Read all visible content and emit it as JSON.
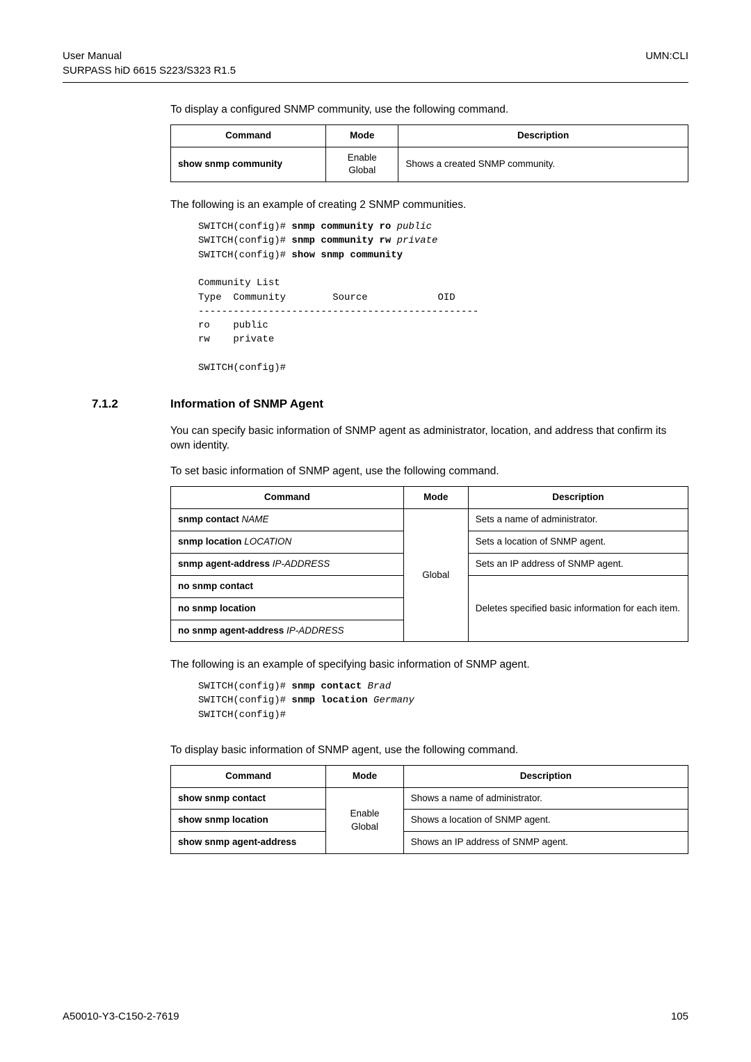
{
  "header": {
    "left_line1": "User Manual",
    "left_line2": "SURPASS hiD 6615 S223/S323 R1.5",
    "right": "UMN:CLI"
  },
  "p1": "To display a configured SNMP community, use the following command.",
  "table1": {
    "h_cmd": "Command",
    "h_mode": "Mode",
    "h_desc": "Description",
    "r1_cmd": "show snmp community",
    "r1_mode1": "Enable",
    "r1_mode2": "Global",
    "r1_desc": "Shows a created SNMP community."
  },
  "p2": "The following is an example of creating 2 SNMP communities.",
  "cli1": {
    "l1a": "SWITCH(config)# ",
    "l1b": "snmp community ro",
    "l1c": " public",
    "l2a": "SWITCH(config)# ",
    "l2b": "snmp community rw",
    "l2c": " private",
    "l3a": "SWITCH(config)# ",
    "l3b": "show snmp community",
    "blank1": "",
    "l4": "Community List",
    "l5": "Type  Community        Source            OID",
    "l6": "------------------------------------------------",
    "l7": "ro    public",
    "l8": "rw    private",
    "blank2": "",
    "l9": "SWITCH(config)#"
  },
  "section": {
    "num": "7.1.2",
    "title": "Information of SNMP Agent"
  },
  "p3": "You can specify basic information of SNMP agent as administrator, location, and address that confirm its own identity.",
  "p4": "To set basic information of SNMP agent, use the following command.",
  "table2": {
    "h_cmd": "Command",
    "h_mode": "Mode",
    "h_desc": "Description",
    "r1_cmd_b": "snmp contact",
    "r1_cmd_i": " NAME",
    "r1_desc": "Sets a name of administrator.",
    "r2_cmd_b": "snmp location",
    "r2_cmd_i": " LOCATION",
    "r2_desc": "Sets a location of SNMP agent.",
    "r3_cmd_b": "snmp agent-address",
    "r3_cmd_i": " IP-ADDRESS",
    "r3_desc": "Sets an IP address of SNMP agent.",
    "mode": "Global",
    "r4_cmd": "no snmp contact",
    "r5_cmd": "no snmp location",
    "r6_cmd_b": "no snmp agent-address",
    "r6_cmd_i": " IP-ADDRESS",
    "del_desc": "Deletes specified basic information for each item."
  },
  "p5": "The following is an example of specifying basic information of SNMP agent.",
  "cli2": {
    "l1a": "SWITCH(config)# ",
    "l1b": "snmp contact",
    "l1c": " Brad",
    "l2a": "SWITCH(config)# ",
    "l2b": "snmp location",
    "l2c": " Germany",
    "l3": "SWITCH(config)#"
  },
  "p6": "To display basic information of SNMP agent, use the following command.",
  "table3": {
    "h_cmd": "Command",
    "h_mode": "Mode",
    "h_desc": "Description",
    "r1_cmd": "show snmp contact",
    "r1_desc": "Shows a name of administrator.",
    "r2_cmd": "show snmp location",
    "r2_desc": "Shows a location of SNMP agent.",
    "r3_cmd": "show snmp agent-address",
    "r3_desc": "Shows an IP address of SNMP agent.",
    "mode1": "Enable",
    "mode2": "Global"
  },
  "footer": {
    "left": "A50010-Y3-C150-2-7619",
    "right": "105"
  }
}
